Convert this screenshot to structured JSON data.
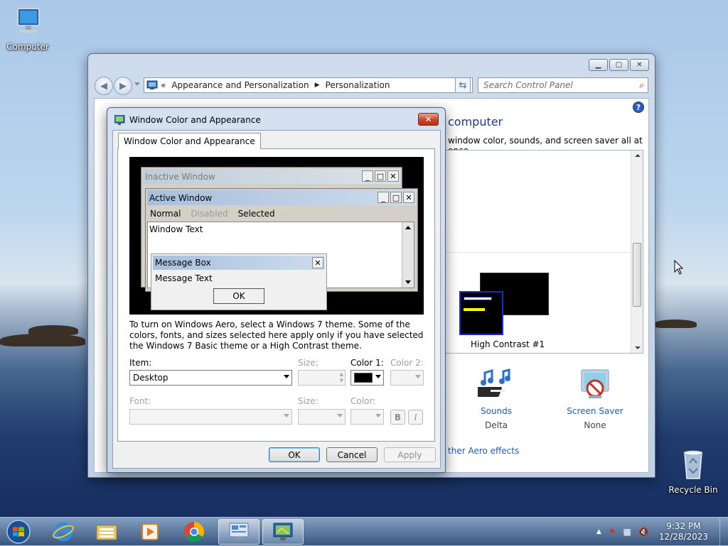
{
  "desktop": {
    "icons": [
      {
        "label": "Computer",
        "icon": "computer-icon"
      },
      {
        "label": "Recycle Bin",
        "icon": "recycle-bin-icon"
      }
    ]
  },
  "control_panel": {
    "breadcrumb_prefix": "«",
    "breadcrumb": [
      "Appearance and Personalization",
      "Personalization"
    ],
    "search_placeholder": "Search Control Panel",
    "heading_fragment": "computer",
    "description_fragment": "window color, sounds, and screen saver all at once.",
    "theme_name": "High Contrast #1",
    "items": [
      {
        "label": "Sounds",
        "value": "Delta",
        "icon": "music-notes-icon"
      },
      {
        "label": "Screen Saver",
        "value": "None",
        "icon": "screen-saver-icon"
      }
    ],
    "aero_link": "ther Aero effects"
  },
  "dialog": {
    "title": "Window Color and Appearance",
    "tab_label": "Window Color and Appearance",
    "preview": {
      "inactive_title": "Inactive Window",
      "active_title": "Active Window",
      "menu_normal": "Normal",
      "menu_disabled": "Disabled",
      "menu_selected": "Selected",
      "window_text": "Window Text",
      "message_box_title": "Message Box",
      "message_text": "Message Text",
      "ok": "OK"
    },
    "info_text": "To turn on Windows Aero, select a Windows 7 theme.  Some of the colors, fonts, and sizes selected here apply only if you have selected the Windows 7 Basic theme or a High Contrast theme.",
    "item_label": "Item:",
    "item_value": "Desktop",
    "size_label": "Size:",
    "color1_label": "Color 1:",
    "color2_label": "Color 2:",
    "color1_value": "#000000",
    "font_label": "Font:",
    "font_size_label": "Size:",
    "font_color_label": "Color:",
    "bold": "B",
    "italic": "I",
    "ok": "OK",
    "cancel": "Cancel",
    "apply": "Apply"
  },
  "taskbar": {
    "items": [
      "start-orb",
      "internet-explorer-icon",
      "file-explorer-icon",
      "media-player-icon",
      "chrome-icon",
      "control-panel-icon",
      "display-settings-icon"
    ],
    "time": "9:32 PM",
    "date": "12/28/2023"
  }
}
